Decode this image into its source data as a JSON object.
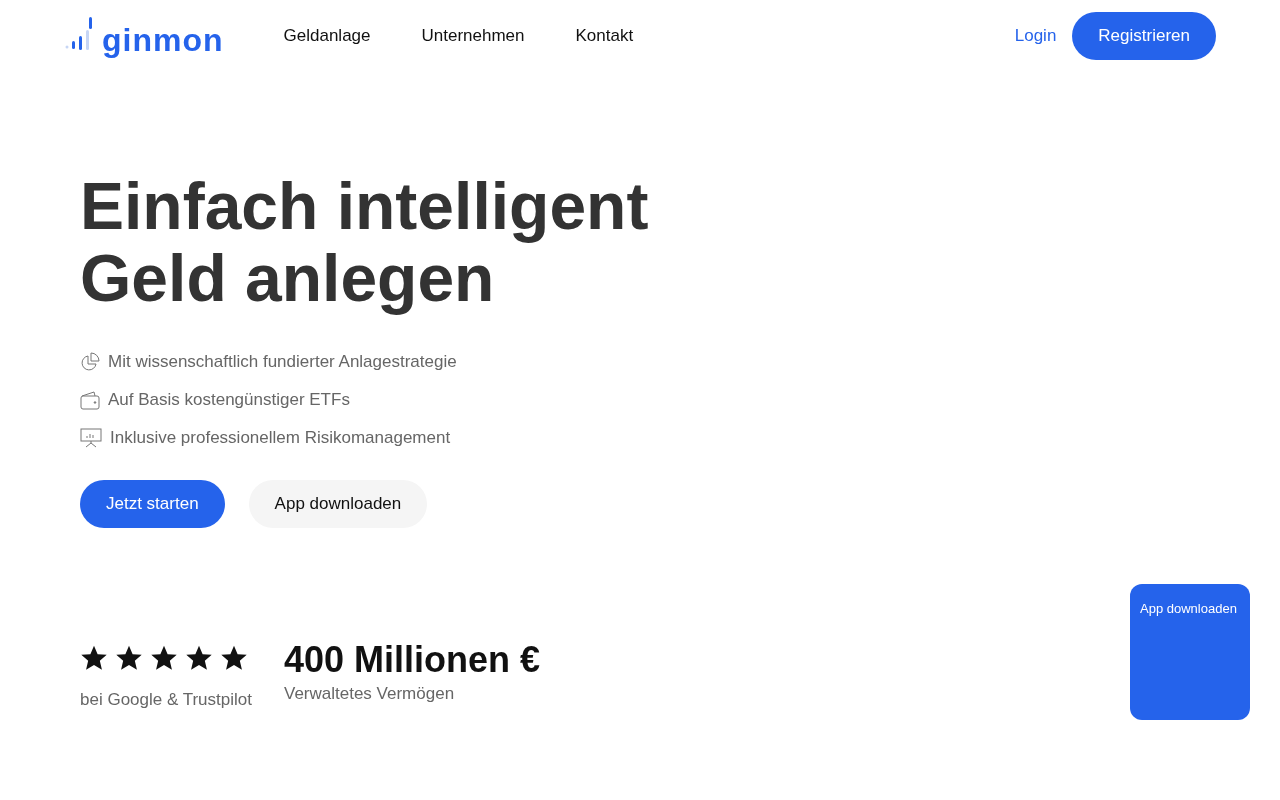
{
  "header": {
    "logo": "ginmon",
    "nav": [
      "Geldanlage",
      "Unternehmen",
      "Kontakt"
    ],
    "login": "Login",
    "register": "Registrieren"
  },
  "hero": {
    "title_lines": [
      "Einfach intelligent",
      "Geld anlegen"
    ],
    "features": [
      {
        "kind": "pie",
        "text": "Mit wissenschaftlich fundierter Anlagestrategie"
      },
      {
        "kind": "wallet",
        "text": "Auf Basis kostengünstiger ETFs"
      },
      {
        "kind": "presentation",
        "text": "Inklusive professionellem Risikomanagement"
      }
    ],
    "buttons": [
      {
        "kind": "primary",
        "label": "Jetzt starten"
      },
      {
        "kind": "secondary",
        "label": "App downloaden"
      }
    ]
  },
  "stats": {
    "rating": {
      "stars": 5,
      "caption": "bei Google & Trustpilot"
    },
    "assets": {
      "value": "400 Millionen €",
      "caption": "Verwaltetes Vermögen"
    }
  },
  "floating_card": {
    "label": "App downloaden"
  }
}
